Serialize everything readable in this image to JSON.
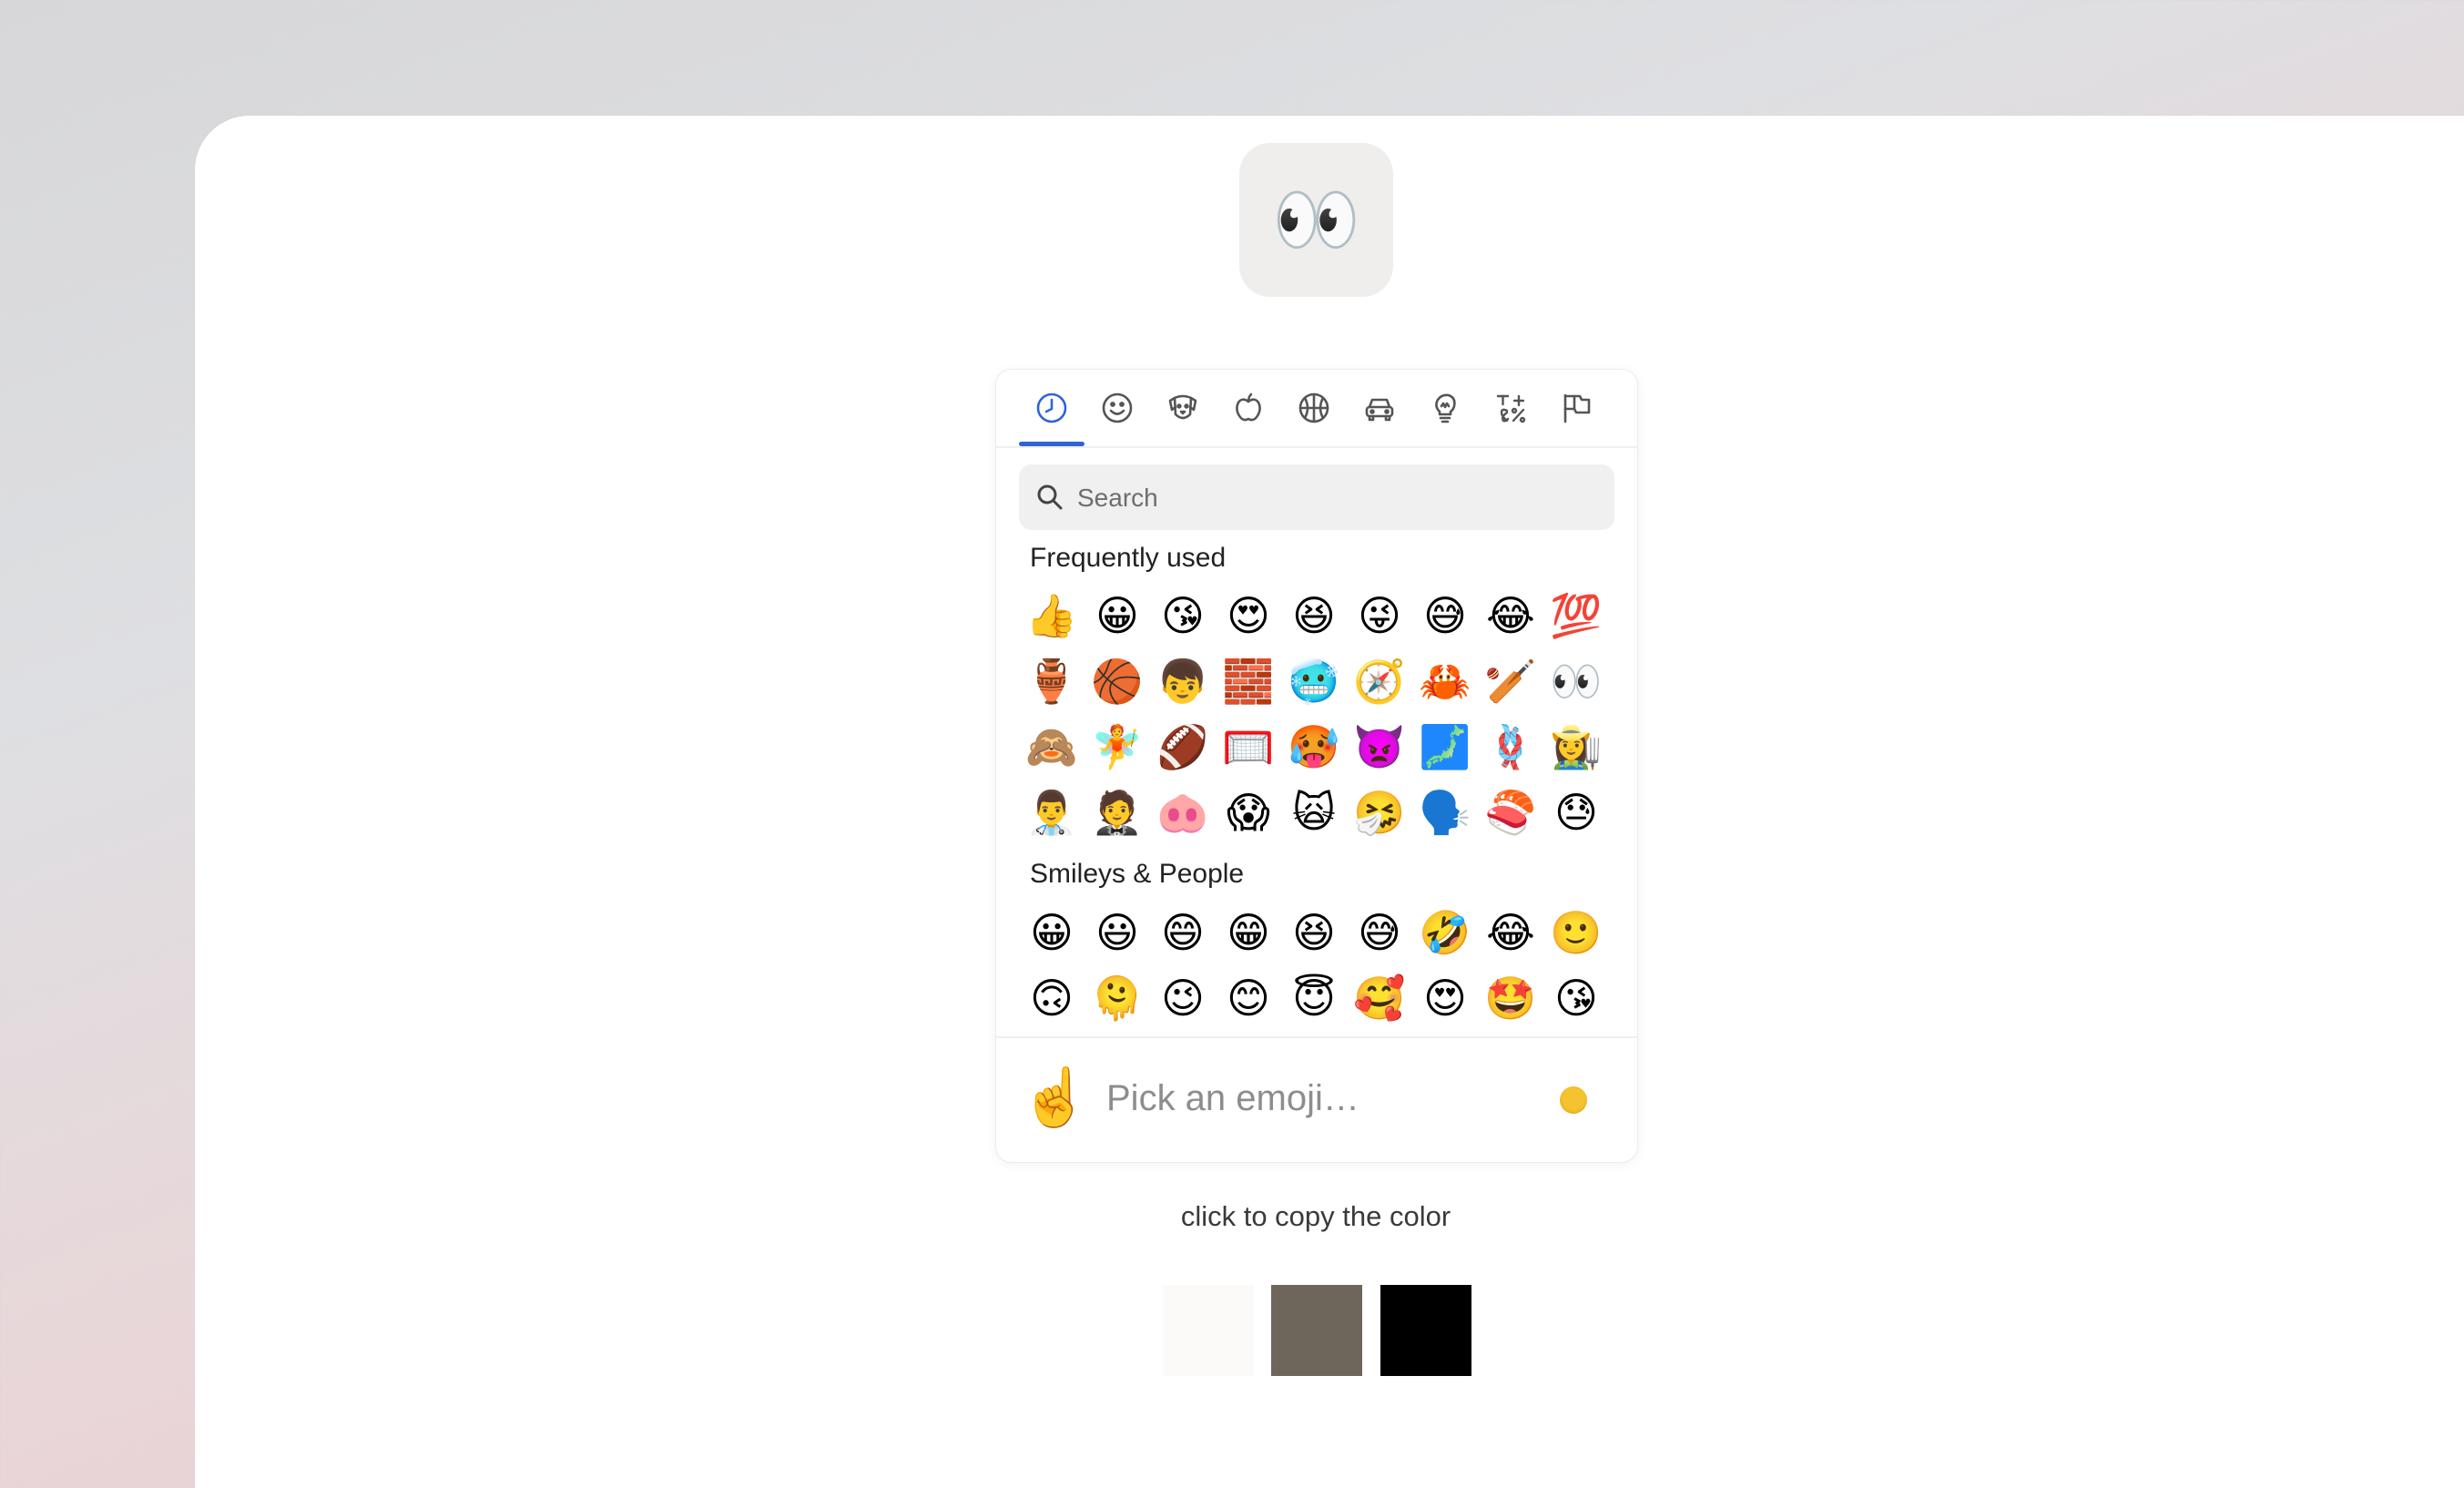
{
  "preview": {
    "emoji": "👀"
  },
  "picker": {
    "tabs": [
      {
        "name": "recent",
        "icon": "clock-icon",
        "active": true
      },
      {
        "name": "smileys",
        "icon": "smiley-icon"
      },
      {
        "name": "animals",
        "icon": "dog-icon"
      },
      {
        "name": "food",
        "icon": "apple-icon"
      },
      {
        "name": "activity",
        "icon": "basketball-icon"
      },
      {
        "name": "travel",
        "icon": "car-icon"
      },
      {
        "name": "objects",
        "icon": "lightbulb-icon"
      },
      {
        "name": "symbols",
        "icon": "symbols-icon"
      },
      {
        "name": "flags",
        "icon": "flag-icon"
      }
    ],
    "search": {
      "placeholder": "Search",
      "value": ""
    },
    "frequent": {
      "title": "Frequently used",
      "emojis": [
        "👍",
        "😀",
        "😘",
        "😍",
        "😆",
        "😜",
        "😅",
        "😂",
        "💯",
        "🏺",
        "🏀",
        "👦",
        "🧱",
        "🥶",
        "🧭",
        "🦀",
        "🏏",
        "👀",
        "🙈",
        "🧚",
        "🏈",
        "🥅",
        "🥵",
        "👿",
        "🗾",
        "🪢",
        "👩‍🌾",
        "👨‍⚕️",
        "🤵",
        "🐽",
        "😱",
        "🙀",
        "🤧",
        "🗣️",
        "🍣",
        "😓"
      ]
    },
    "smileys": {
      "title": "Smileys & People",
      "emojis": [
        "😀",
        "😃",
        "😄",
        "😁",
        "😆",
        "😅",
        "🤣",
        "😂",
        "🙂",
        "🙃",
        "🫠",
        "😉",
        "😊",
        "😇",
        "🥰",
        "😍",
        "🤩",
        "😘"
      ]
    },
    "footer": {
      "emoji": "☝️",
      "text": "Pick an emoji…",
      "skin_tone_color": "#f5c330"
    }
  },
  "copy_hint": "click to copy the color",
  "swatches": [
    {
      "color": "#fbfaf8"
    },
    {
      "color": "#6f665b"
    },
    {
      "color": "#000000"
    }
  ],
  "colors": {
    "accent": "#2f64d6",
    "tab_icon": "#555555"
  }
}
